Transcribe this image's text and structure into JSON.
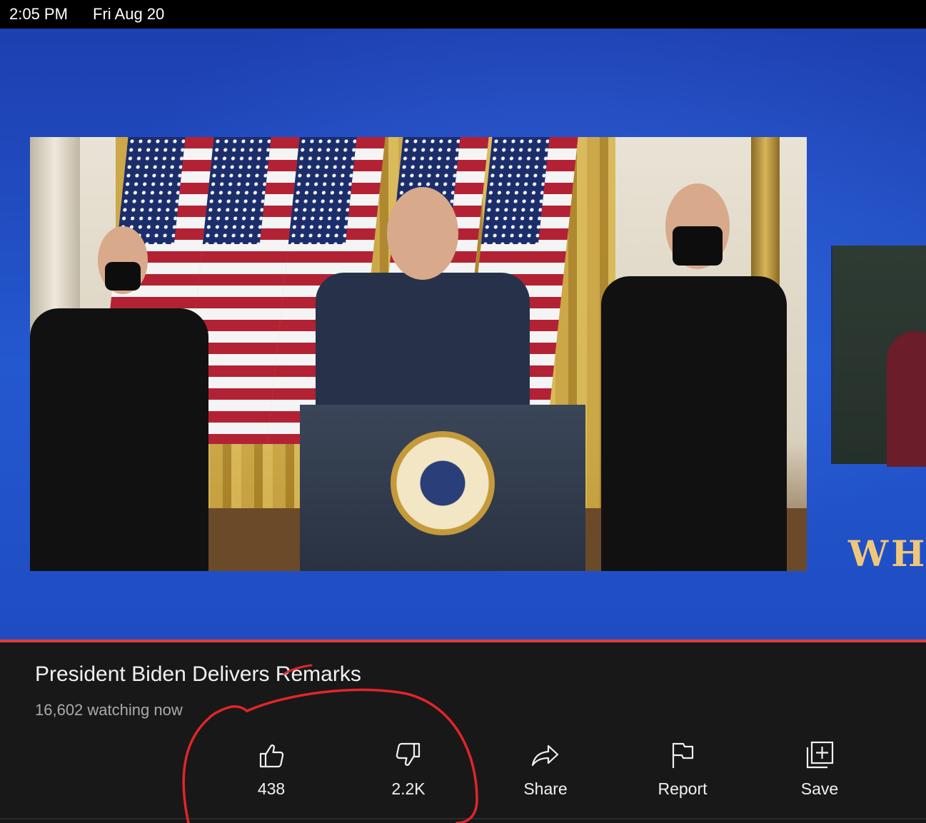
{
  "status_bar": {
    "time": "2:05 PM",
    "date": "Fri Aug 20"
  },
  "player": {
    "overlay_text": "WH",
    "state": "live"
  },
  "video": {
    "title": "President Biden Delivers Remarks",
    "watching": "16,602 watching now"
  },
  "actions": [
    {
      "id": "like",
      "label": "438",
      "icon": "thumbs-up-icon"
    },
    {
      "id": "dislike",
      "label": "2.2K",
      "icon": "thumbs-down-icon"
    },
    {
      "id": "share",
      "label": "Share",
      "icon": "share-arrow-icon"
    },
    {
      "id": "report",
      "label": "Report",
      "icon": "flag-icon"
    },
    {
      "id": "save",
      "label": "Save",
      "icon": "add-to-playlist-icon"
    }
  ],
  "colors": {
    "background": "#181818",
    "text": "#f1f1f1",
    "secondary_text": "#aaaaaa",
    "progress": "#e53935",
    "annotation": "#e0252b"
  }
}
